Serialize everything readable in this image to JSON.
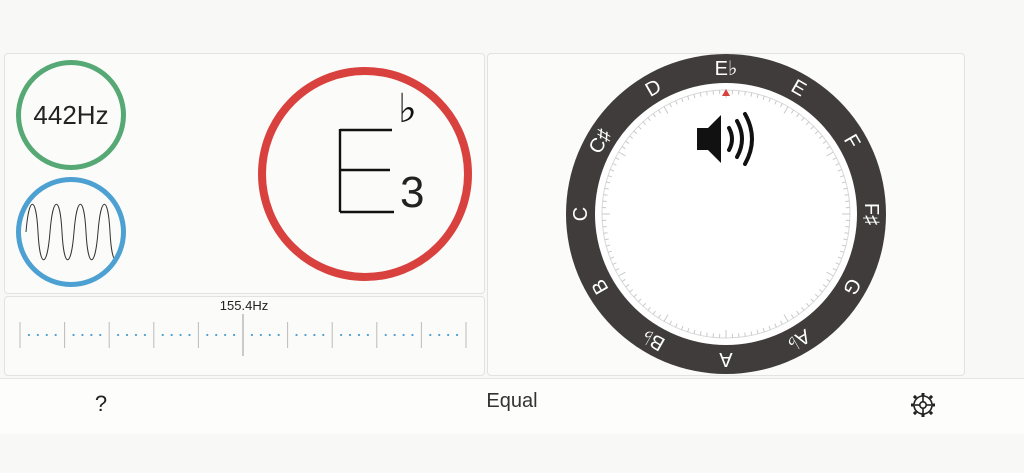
{
  "reference_pitch": "442Hz",
  "note": {
    "letter": "E",
    "accidental": "♭",
    "octave": "3"
  },
  "frequency_readout": "155.4Hz",
  "dial": {
    "notes": [
      {
        "label": "E♭",
        "angle": 0
      },
      {
        "label": "E",
        "angle": 30
      },
      {
        "label": "F",
        "angle": 60
      },
      {
        "label": "F♯",
        "angle": 90
      },
      {
        "label": "G",
        "angle": 120
      },
      {
        "label": "A♭",
        "angle": 150
      },
      {
        "label": "A",
        "angle": 180
      },
      {
        "label": "B♭",
        "angle": 210
      },
      {
        "label": "B",
        "angle": 240
      },
      {
        "label": "C",
        "angle": 270
      },
      {
        "label": "C♯",
        "angle": 300
      },
      {
        "label": "D",
        "angle": 330
      }
    ],
    "pointer_angle": 0,
    "speaker_icon": "speaker-volume-icon"
  },
  "footer": {
    "help_label": "?",
    "temperament": "Equal",
    "settings_icon": "settings-gear-icon"
  },
  "colors": {
    "reference_ring": "#56a874",
    "waveform_ring": "#4da0d2",
    "note_ring": "#d8413d",
    "dial_ring": "#3f3c3b",
    "pointer": "#d8413d",
    "cents_dots": "#4da0d2"
  }
}
